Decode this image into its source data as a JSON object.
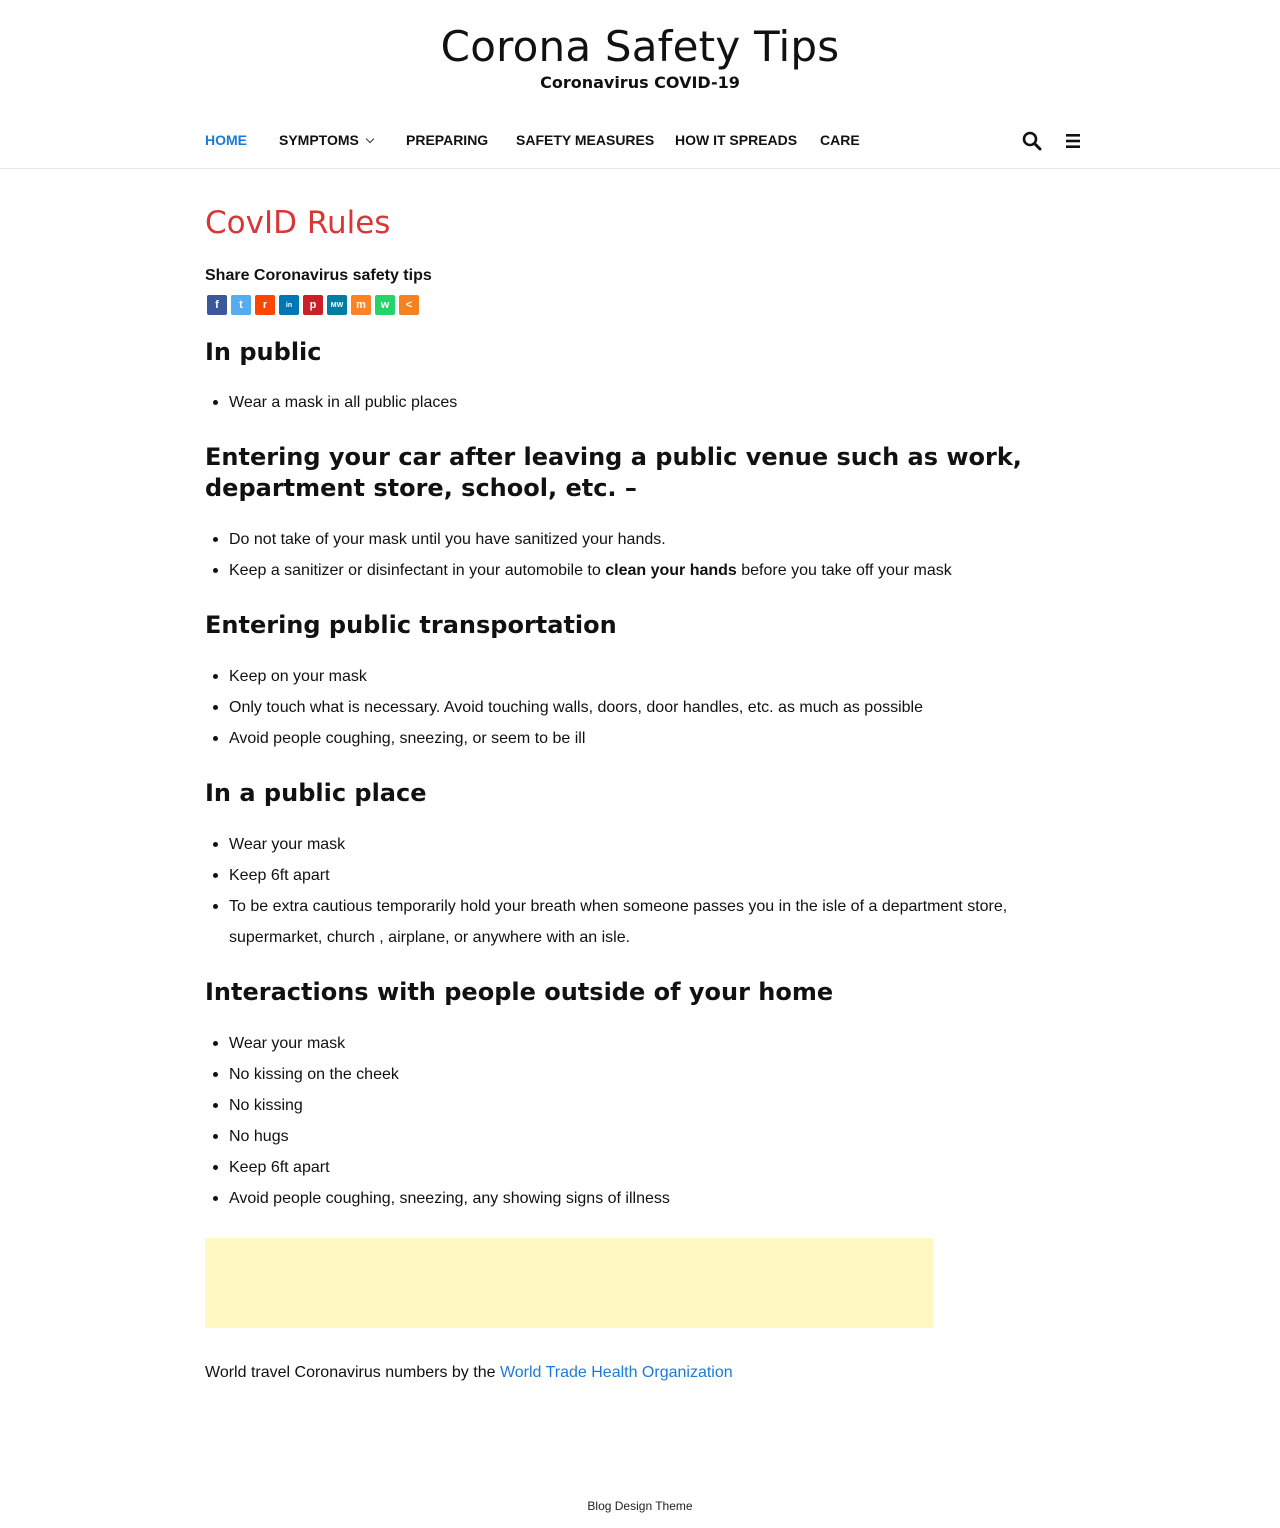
{
  "site": {
    "title": "Corona Safety Tips",
    "tagline": "Coronavirus COVID-19"
  },
  "nav": {
    "items": [
      {
        "label": "HOME",
        "active": true
      },
      {
        "label": "SYMPTOMS",
        "has_dropdown": true
      },
      {
        "label": "PREPARING"
      },
      {
        "label": "SAFETY MEASURES"
      },
      {
        "label": "HOW IT SPREADS"
      },
      {
        "label": "CARE"
      }
    ],
    "icons": [
      "search-icon",
      "menu-icon"
    ]
  },
  "post": {
    "title": "CovID Rules",
    "share_label": "Share Coronavirus safety tips",
    "share_buttons": [
      {
        "name": "facebook",
        "color": "#3b5998",
        "glyph": "f"
      },
      {
        "name": "twitter",
        "color": "#55acee",
        "glyph": "t"
      },
      {
        "name": "reddit",
        "color": "#ff4500",
        "glyph": "r"
      },
      {
        "name": "linkedin",
        "color": "#0077b5",
        "glyph": "in"
      },
      {
        "name": "pinterest",
        "color": "#cb2027",
        "glyph": "p"
      },
      {
        "name": "mewe",
        "color": "#007da1",
        "glyph": "MW"
      },
      {
        "name": "mix",
        "color": "#ff8226",
        "glyph": "m"
      },
      {
        "name": "whatsapp",
        "color": "#25d366",
        "glyph": "w"
      },
      {
        "name": "more",
        "color": "#f58220",
        "glyph": "<"
      }
    ],
    "sections": [
      {
        "heading": "In public",
        "items": [
          "Wear a mask in all public places"
        ]
      },
      {
        "heading_line1": "Entering your car after leaving a public venue such as work,",
        "heading_line2": "department store, school, etc. –",
        "items": [
          "Do not take of your mask until you have sanitized your hands.",
          {
            "before": "Keep a sanitizer or disinfectant in your automobile to ",
            "bold": "clean your hands",
            "after": " before you take off your mask"
          }
        ]
      },
      {
        "heading": "Entering public transportation",
        "items": [
          "Keep on your mask",
          "Only touch what is necessary. Avoid touching walls, doors, door handles, etc. as much as possible",
          "Avoid people coughing, sneezing, or seem to be ill"
        ]
      },
      {
        "heading": "In a public place",
        "items": [
          "Wear your mask",
          "Keep 6ft apart",
          {
            "line1": "To be extra cautious temporarily hold your breath when someone passes you in the isle of a department store,",
            "line2": "supermarket, church , airplane, or anywhere with an isle."
          }
        ]
      },
      {
        "heading": "Interactions with people outside of your home",
        "items": [
          "Wear your mask",
          "No kissing on the cheek",
          "No kissing",
          "No hugs",
          "Keep 6ft apart",
          "Avoid people coughing, sneezing, any showing signs of illness"
        ]
      }
    ],
    "travel_text": "World travel Coronavirus numbers by the ",
    "travel_link": "World Trade Health Organization"
  },
  "footer": {
    "credit": "Blog Design Theme"
  },
  "colors": {
    "accent_link": "#1a7bd6",
    "post_title": "#d93636",
    "ad_background": "#fff8c3"
  }
}
